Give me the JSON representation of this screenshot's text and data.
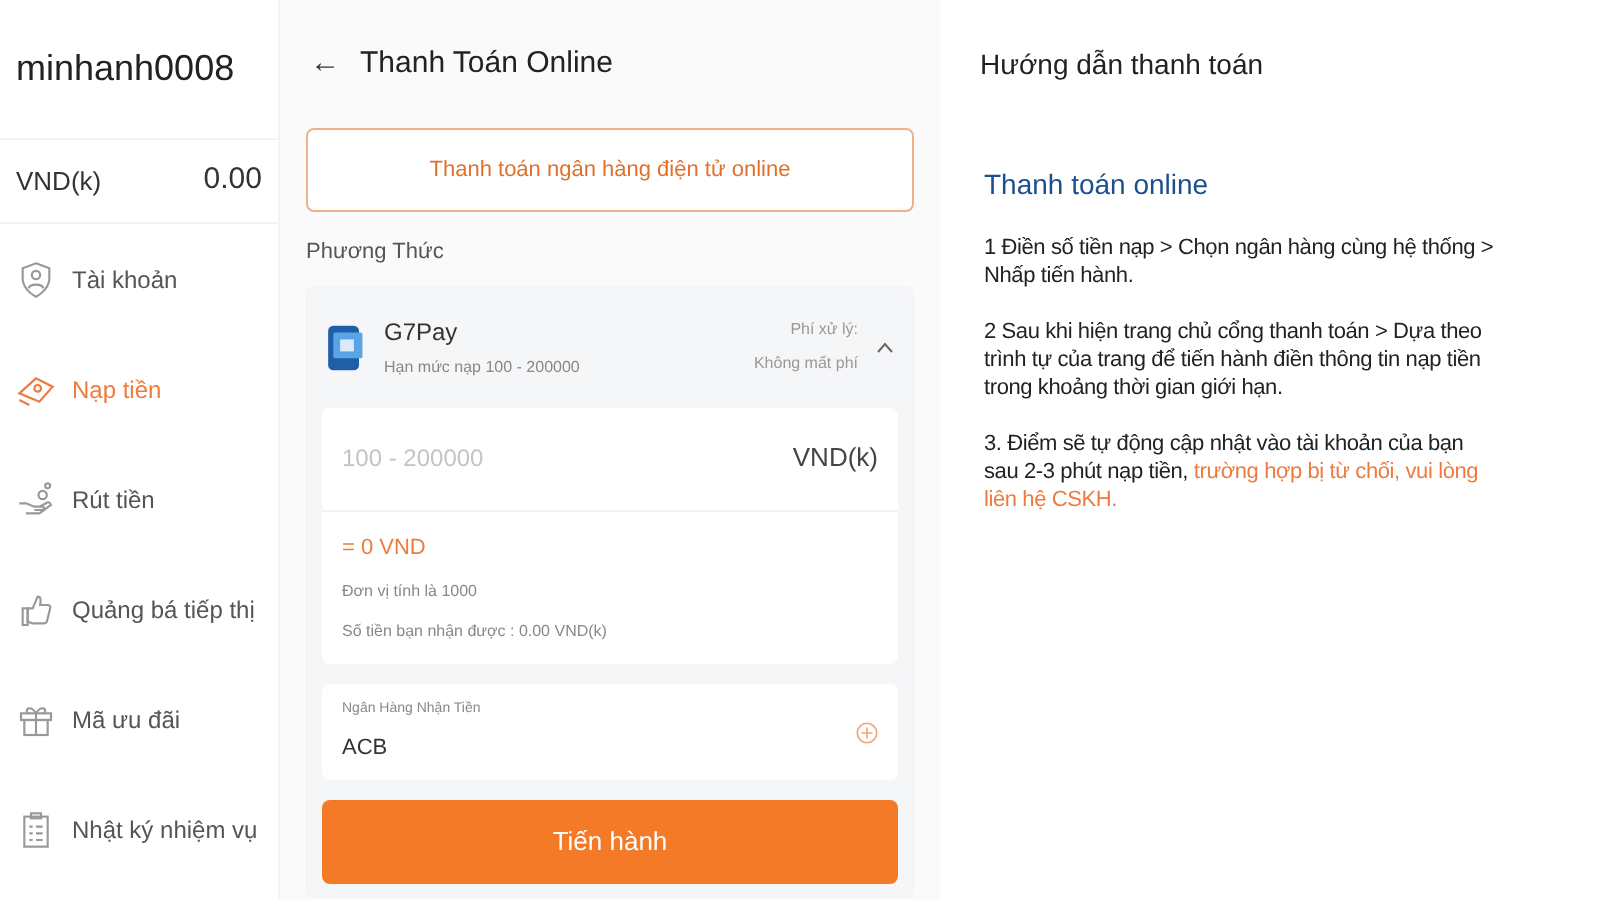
{
  "sidebar": {
    "username": "minhanh0008",
    "balance_label": "VND(k)",
    "balance": "0.00",
    "items": [
      {
        "label": "Tài khoản",
        "selected": false
      },
      {
        "label": "Nạp tiền",
        "selected": true
      },
      {
        "label": "Rút tiền",
        "selected": false
      },
      {
        "label": "Quảng bá tiếp thị",
        "selected": false
      },
      {
        "label": "Mã ưu đãi",
        "selected": false
      },
      {
        "label": "Nhật ký nhiệm vụ",
        "selected": false
      }
    ]
  },
  "main": {
    "back": "←",
    "title": "Thanh Toán Online",
    "channel": "Thanh toán ngân hàng điện tử online",
    "method_label": "Phương Thức",
    "method": {
      "name": "G7Pay",
      "limit": "Hạn mức nạp 100 - 200000",
      "fee_label": "Phí xử lý:",
      "fee": "Không mất phí",
      "expanded": true
    },
    "amount": {
      "placeholder": "100 - 200000",
      "unit": "VND(k)"
    },
    "converted": "= 0 VND",
    "unit_note": "Đơn vị tính là 1000",
    "received": "Số tiền bạn nhận được : 0.00 VND(k)",
    "bank": {
      "label": "Ngân Hàng Nhận Tiền",
      "value": "ACB"
    },
    "submit": "Tiến hành"
  },
  "guide": {
    "title": "Hướng dẫn thanh toán",
    "subtitle": "Thanh toán online",
    "steps": [
      {
        "text": "1 Điền số tiền nạp > Chọn ngân hàng cùng hệ thống > Nhấp tiến hành."
      },
      {
        "text": "2 Sau khi hiện trang chủ cổng thanh toán > Dựa theo trình tự của trang để tiến hành điền thông tin nạp tiền trong khoảng thời gian giới hạn."
      },
      {
        "text": "3. Điểm sẽ tự động cập nhật vào tài khoản của bạn sau 2-3 phút nạp tiền,",
        "highlight": "trường hợp bị từ chối, vui lòng liên hệ CSKH."
      }
    ]
  }
}
